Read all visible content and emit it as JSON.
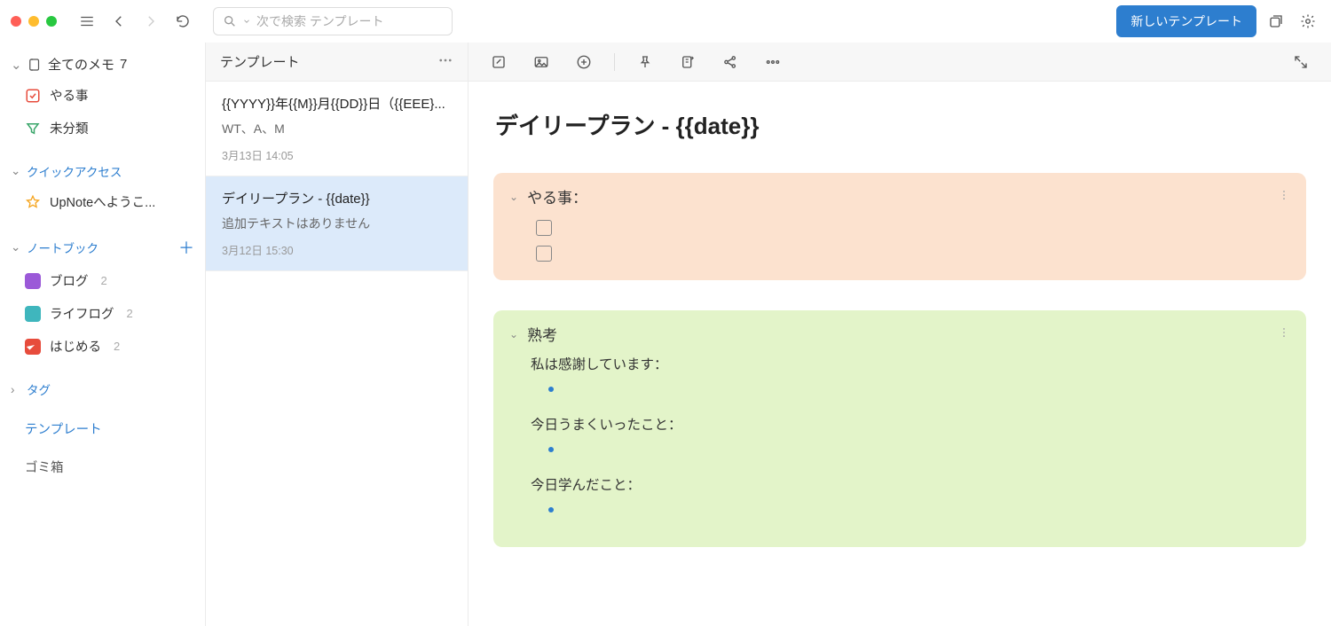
{
  "topbar": {
    "search_placeholder": "次で検索 テンプレート",
    "new_template": "新しいテンプレート"
  },
  "sidebar": {
    "all_notes": {
      "label": "全てのメモ",
      "count": "7"
    },
    "todo": {
      "label": "やる事"
    },
    "uncategorized": {
      "label": "未分類"
    },
    "quick_access_header": "クイックアクセス",
    "quick_access_items": [
      {
        "label": "UpNoteへようこ..."
      }
    ],
    "notebooks_header": "ノートブック",
    "notebooks": [
      {
        "label": "ブログ",
        "count": "2",
        "color": "nb-purple"
      },
      {
        "label": "ライフログ",
        "count": "2",
        "color": "nb-teal"
      },
      {
        "label": "はじめる",
        "count": "2",
        "color": "nb-red"
      }
    ],
    "tags_header": "タグ",
    "templates_link": "テンプレート",
    "trash": "ゴミ箱"
  },
  "list": {
    "header": "テンプレート",
    "items": [
      {
        "title": "{{YYYY}}年{{M}}月{{DD}}日（{{EEE}...",
        "snippet": "WT、A、M",
        "date": "3月13日 14:05",
        "selected": false
      },
      {
        "title": "デイリープラン - {{date}}",
        "snippet": "追加テキストはありません",
        "date": "3月12日 15:30",
        "selected": true
      }
    ]
  },
  "editor": {
    "title": "デイリープラン - {{date}}",
    "blocks": {
      "todo": {
        "heading": "やる事："
      },
      "reflect": {
        "heading": "熟考",
        "items": [
          "私は感謝しています：",
          "今日うまくいったこと：",
          "今日学んだこと："
        ]
      }
    }
  }
}
